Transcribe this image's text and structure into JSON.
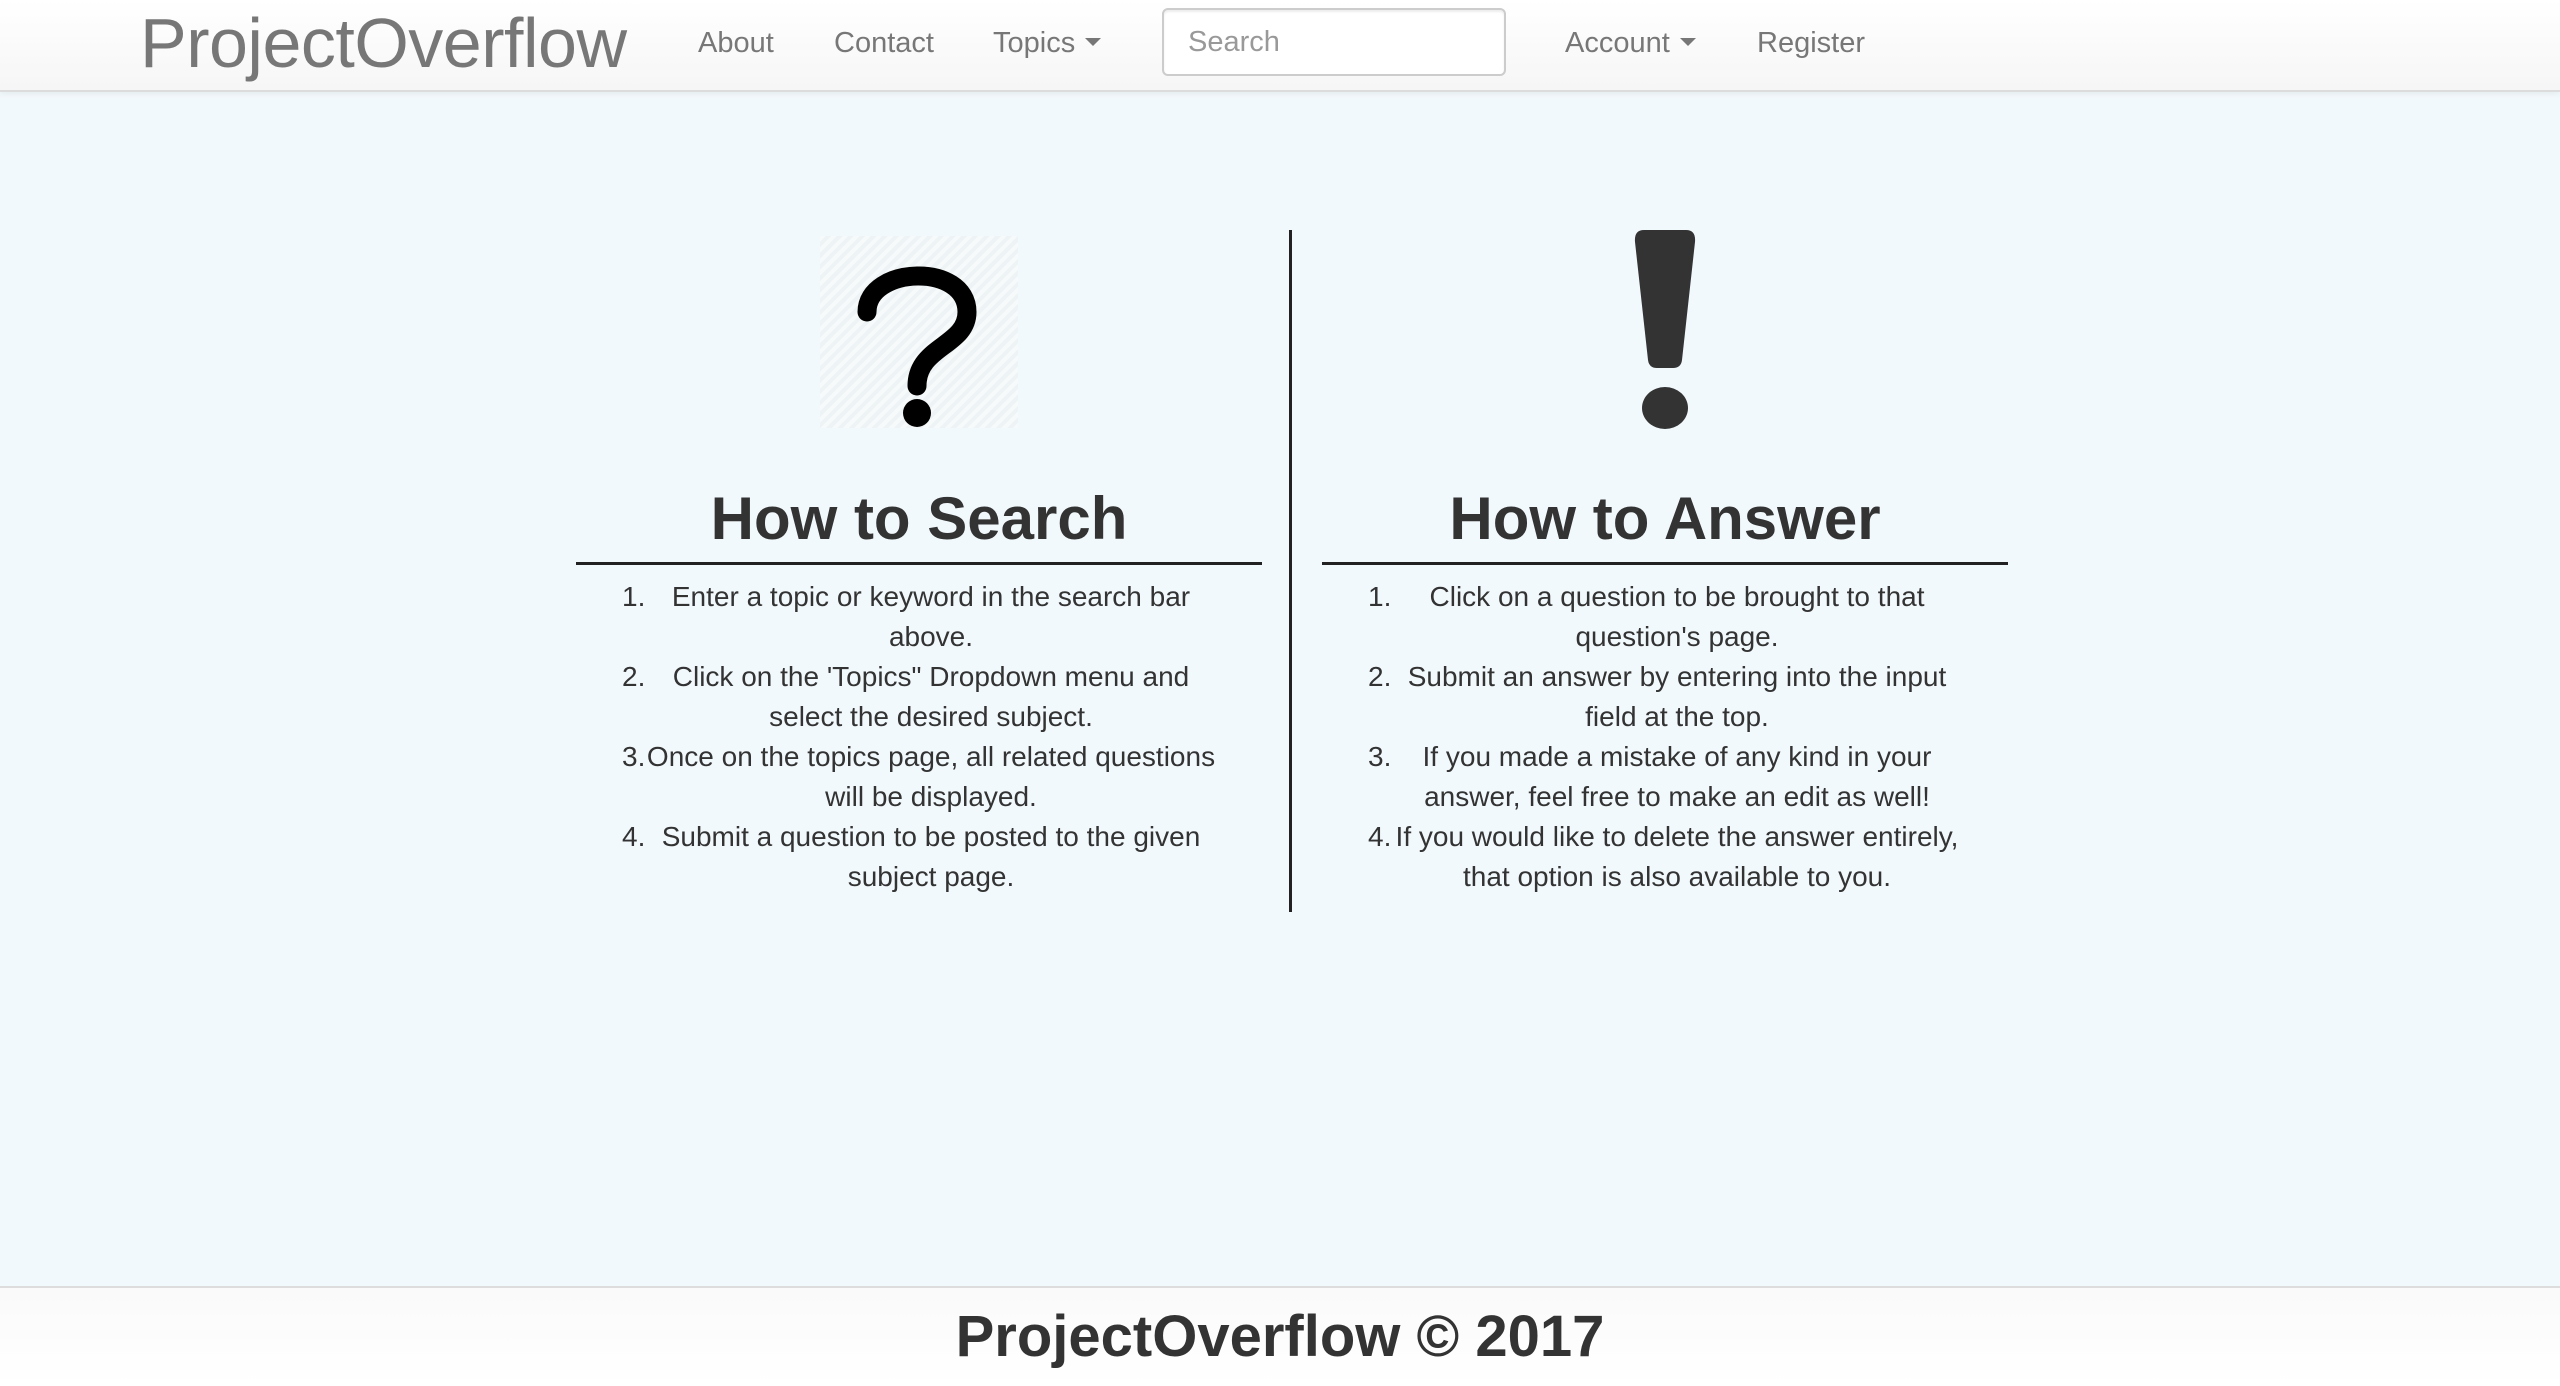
{
  "navbar": {
    "brand": "ProjectOverflow",
    "links": {
      "about": "About",
      "contact": "Contact",
      "topics": "Topics",
      "account": "Account",
      "register": "Register"
    },
    "search": {
      "placeholder": "Search",
      "value": ""
    }
  },
  "sections": {
    "search": {
      "icon": "question-mark-icon",
      "title": "How to Search",
      "steps": [
        "Enter a topic or keyword in the search bar above.",
        "Click on the 'Topics\" Dropdown menu and select the desired subject.",
        "Once on the topics page, all related questions will be displayed.",
        "Submit a question to be posted to the given subject page."
      ]
    },
    "answer": {
      "icon": "exclamation-mark-icon",
      "title": "How to Answer",
      "steps": [
        "Click on a question to be brought to that question's page.",
        "Submit an answer by entering into the input field at the top.",
        "If you made a mistake of any kind in your answer, feel free to make an edit as well!",
        "If you would like to delete the answer entirely, that option is also available to you."
      ]
    }
  },
  "step_numbers": [
    "1.",
    "2.",
    "3.",
    "4."
  ],
  "footer": {
    "text": "ProjectOverflow © 2017"
  },
  "colors": {
    "page_background": "#f2f9fc",
    "nav_text": "#777777",
    "heading_text": "#333333",
    "rule": "#222222"
  }
}
